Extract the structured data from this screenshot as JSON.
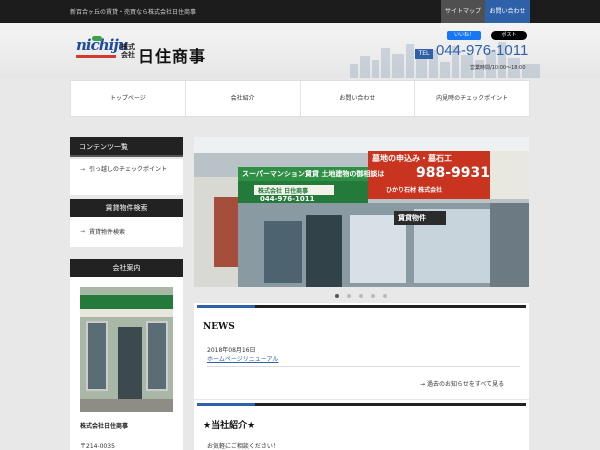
{
  "topbar": {
    "tagline": "新百合ヶ丘の賃貸・売買なら株式会社日住商事",
    "sitemap": "サイトマップ",
    "contact": "お問い合わせ"
  },
  "header": {
    "logo_mark": "nichiju",
    "logo_kaisha": "株式会社",
    "logo_name": "日住商事",
    "like_button": "いいね！",
    "post_button": "ポスト",
    "tel_label": "TEL",
    "tel_number": "044-976-1011",
    "hours": "営業時間/10:00～18:00"
  },
  "nav": {
    "items": [
      {
        "label": "トップページ"
      },
      {
        "label": "会社紹介"
      },
      {
        "label": "お問い合わせ"
      },
      {
        "label": "内見時のチェックポイント"
      }
    ]
  },
  "sidebar": {
    "contents_heading": "コンテンツ一覧",
    "contents_items": [
      "引っ越しのチェックポイント"
    ],
    "rental_heading": "賃貸物件検索",
    "rental_items": [
      "賃貸物件検索"
    ],
    "company_heading": "会社案内",
    "company_name": "株式会社日住商事",
    "postal": "〒214-0035"
  },
  "slider": {
    "sign_top": "スーパーマンション賃貸 土地建物の御相談は",
    "sign_shop": "株式会社 日住商事",
    "sign_tel": "044-976-1011",
    "sign_right_top": "墓地の申込み・墓石工",
    "sign_right_tel": "988-9931",
    "sign_right_name": "ひかり石材 株式会社",
    "sign_rental": "賃貸物件",
    "dots": 5,
    "active_dot": 1
  },
  "news": {
    "title": "NEWS",
    "date": "2018年08月16日",
    "link": "ホームページリニューアル",
    "more": "過去のお知らせをすべて見る"
  },
  "about": {
    "title": "★当社紹介★",
    "text": "お気軽にご相談ください！"
  },
  "colors": {
    "accent": "#2f61a8",
    "dark": "#222222",
    "sign_green": "#237a3a",
    "sign_red": "#c8341f"
  }
}
